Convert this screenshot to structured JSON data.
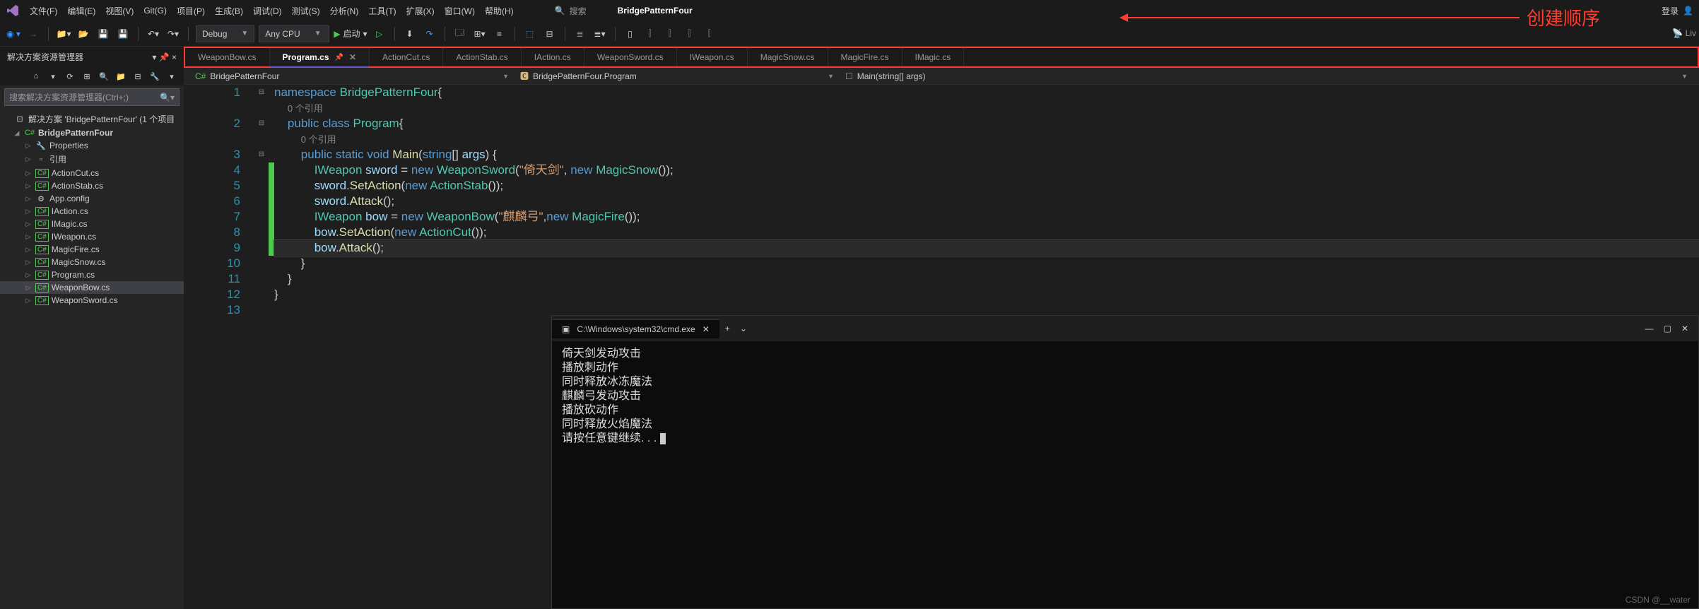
{
  "menu": {
    "items": [
      "文件(F)",
      "编辑(E)",
      "视图(V)",
      "Git(G)",
      "项目(P)",
      "生成(B)",
      "调试(D)",
      "测试(S)",
      "分析(N)",
      "工具(T)",
      "扩展(X)",
      "窗口(W)",
      "帮助(H)"
    ]
  },
  "search": {
    "placeholder": "搜索"
  },
  "project_name": "BridgePatternFour",
  "login": "登录",
  "annotation": "创建顺序",
  "toolbar": {
    "config": "Debug",
    "platform": "Any CPU",
    "run": "启动"
  },
  "sidebar": {
    "title": "解决方案资源管理器",
    "search_placeholder": "搜索解决方案资源管理器(Ctrl+;)",
    "solution": "解决方案 'BridgePatternFour' (1 个项目",
    "project": "BridgePatternFour",
    "items": [
      {
        "label": "Properties",
        "ico": "🔧"
      },
      {
        "label": "引用",
        "ico": "▫"
      },
      {
        "label": "ActionCut.cs",
        "ico": "C#"
      },
      {
        "label": "ActionStab.cs",
        "ico": "C#"
      },
      {
        "label": "App.config",
        "ico": "⚙"
      },
      {
        "label": "IAction.cs",
        "ico": "C#"
      },
      {
        "label": "IMagic.cs",
        "ico": "C#"
      },
      {
        "label": "IWeapon.cs",
        "ico": "C#"
      },
      {
        "label": "MagicFire.cs",
        "ico": "C#"
      },
      {
        "label": "MagicSnow.cs",
        "ico": "C#"
      },
      {
        "label": "Program.cs",
        "ico": "C#"
      },
      {
        "label": "WeaponBow.cs",
        "ico": "C#",
        "sel": true
      },
      {
        "label": "WeaponSword.cs",
        "ico": "C#"
      }
    ]
  },
  "tabs": [
    "WeaponBow.cs",
    "Program.cs",
    "ActionCut.cs",
    "ActionStab.cs",
    "IAction.cs",
    "WeaponSword.cs",
    "IWeapon.cs",
    "MagicSnow.cs",
    "MagicFire.cs",
    "IMagic.cs"
  ],
  "active_tab": 1,
  "nav": {
    "left": "BridgePatternFour",
    "mid": "BridgePatternFour.Program",
    "right": "Main(string[] args)"
  },
  "code": {
    "line_numbers": [
      1,
      2,
      3,
      4,
      5,
      6,
      7,
      8,
      9,
      10,
      11,
      12,
      13
    ],
    "ref_hint": "0 个引用"
  },
  "terminal": {
    "title": "C:\\Windows\\system32\\cmd.exe",
    "lines": [
      "倚天剑发动攻击",
      "播放刺动作",
      "同时释放冰冻魔法",
      "麒麟弓发动攻击",
      "播放砍动作",
      "同时释放火焰魔法",
      "请按任意键继续. . . "
    ]
  },
  "watermark": "CSDN @__water",
  "live_share": "Liv"
}
